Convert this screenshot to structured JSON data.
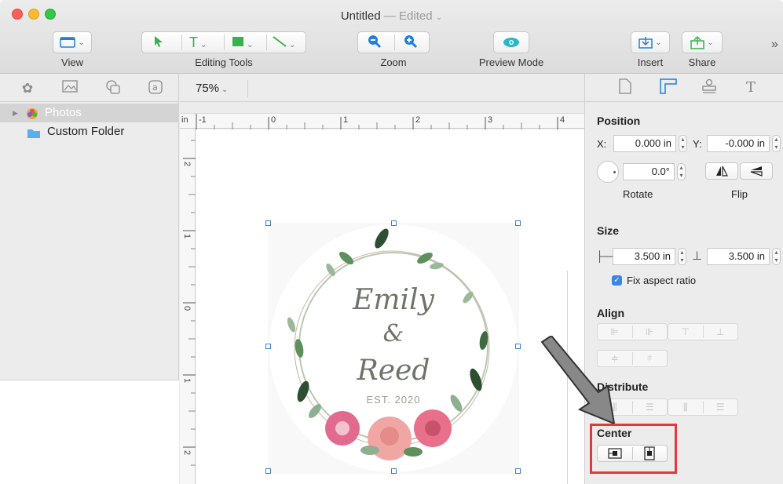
{
  "window": {
    "title": "Untitled",
    "edited": "— Edited"
  },
  "toolbar": {
    "view_label": "View",
    "editing_tools_label": "Editing Tools",
    "zoom_label": "Zoom",
    "preview_label": "Preview Mode",
    "insert_label": "Insert",
    "share_label": "Share",
    "overflow": "»"
  },
  "sidebar": {
    "tabs": [
      "gear-flower-icon",
      "image-icon",
      "shapes-icon",
      "text-icon"
    ],
    "items": [
      {
        "label": "Photos",
        "selected": true
      },
      {
        "label": "Custom Folder",
        "selected": false
      }
    ]
  },
  "canvas": {
    "zoom": "75%",
    "ruler_unit": "in",
    "ruler_top": [
      "-1",
      "0",
      "1",
      "2",
      "3",
      "4"
    ],
    "ruler_left": [
      "2",
      "1",
      "0",
      "1",
      "2"
    ],
    "design": {
      "name1": "Emily",
      "amp": "&",
      "name2": "Reed",
      "est": "EST. 2020"
    }
  },
  "inspector": {
    "position_title": "Position",
    "x_label": "X:",
    "x_value": "0.000 in",
    "y_label": "Y:",
    "y_value": "-0.000 in",
    "rotate_value": "0.0°",
    "rotate_label": "Rotate",
    "flip_label": "Flip",
    "size_title": "Size",
    "width_value": "3.500 in",
    "height_value": "3.500 in",
    "fix_aspect": "Fix aspect ratio",
    "align_title": "Align",
    "distribute_title": "Distribute",
    "center_title": "Center"
  },
  "colors": {
    "accent": "#3a86e6",
    "highlight_box": "#e23a3a"
  }
}
